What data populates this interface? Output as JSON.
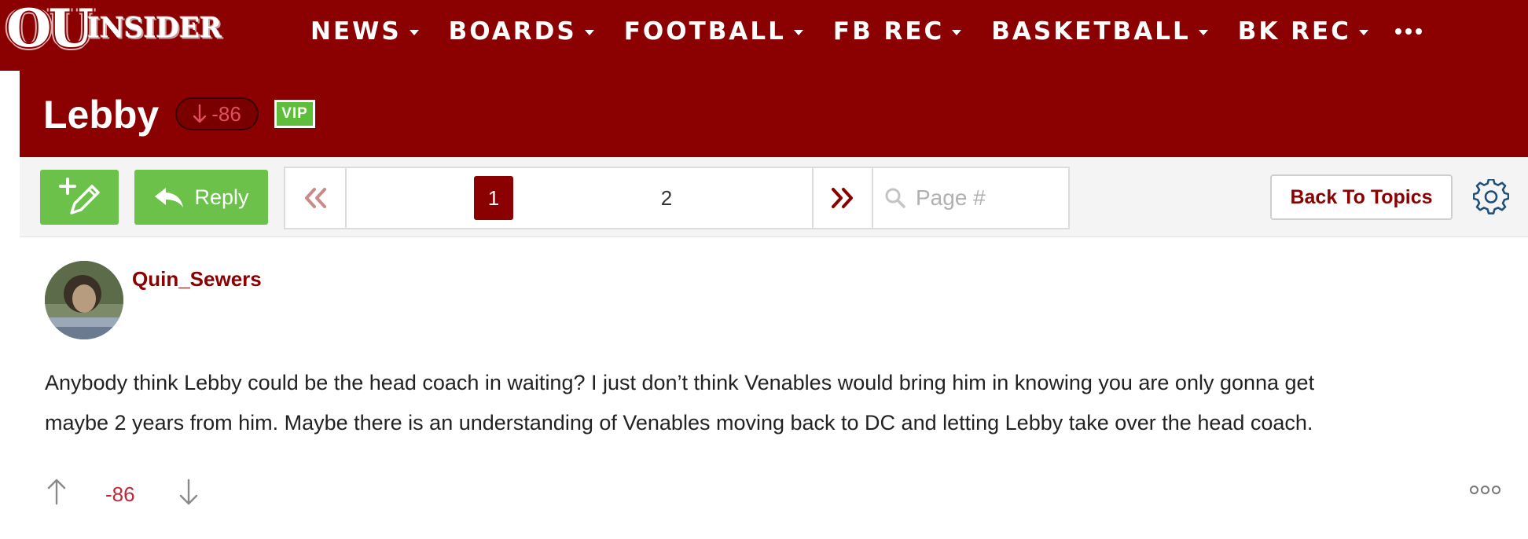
{
  "logo": {
    "ou": "OU",
    "insider": "INSIDER"
  },
  "nav": {
    "items": [
      {
        "label": "NEWS"
      },
      {
        "label": "BOARDS"
      },
      {
        "label": "FOOTBALL"
      },
      {
        "label": "FB REC"
      },
      {
        "label": "BASKETBALL"
      },
      {
        "label": "BK REC"
      }
    ],
    "more_icon": "ellipsis-icon"
  },
  "topic": {
    "title": "Lebby",
    "score": "-86",
    "score_icon": "arrow-down-icon",
    "badge": "VIP"
  },
  "toolbar": {
    "new_topic_icon": "new-topic-icon",
    "reply_label": "Reply",
    "reply_icon": "reply-icon",
    "pages": [
      "1",
      "2"
    ],
    "current_page": "1",
    "page_placeholder": "Page #",
    "back_label": "Back To Topics",
    "settings_icon": "gear-icon"
  },
  "post": {
    "username": "Quin_Sewers",
    "body": [
      "Anybody think Lebby could be the head coach in waiting? I just don’t think Venables would bring him in knowing you are only gonna get",
      "maybe 2 years from him. Maybe there is an understanding of Venables moving back to DC and letting Lebby take over the head coach."
    ],
    "score": "-86"
  },
  "colors": {
    "brand": "#8b0000",
    "green": "#6bc14a",
    "negative": "#c0283a",
    "toolbar_bg": "#f4f4f4"
  }
}
